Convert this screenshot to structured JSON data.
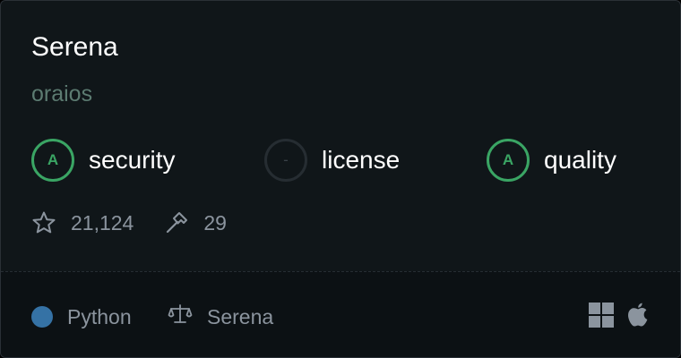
{
  "card": {
    "title": "Serena",
    "owner": "oraios",
    "scores": [
      {
        "grade": "A",
        "label": "security"
      },
      {
        "grade": "-",
        "label": "license"
      },
      {
        "grade": "A",
        "label": "quality"
      }
    ],
    "stats": {
      "stars": "21,124",
      "tools": "29",
      "star_icon": "star-icon",
      "tools_icon": "hammer-icon"
    },
    "footer": {
      "language": "Python",
      "language_color": "#3572a5",
      "license": "Serena",
      "license_icon": "scale-icon",
      "platforms": [
        "windows-icon",
        "apple-icon"
      ]
    }
  },
  "colors": {
    "grade_good": "#3aa564",
    "muted_text": "#8b949e",
    "owner_text": "#5c7b71"
  }
}
